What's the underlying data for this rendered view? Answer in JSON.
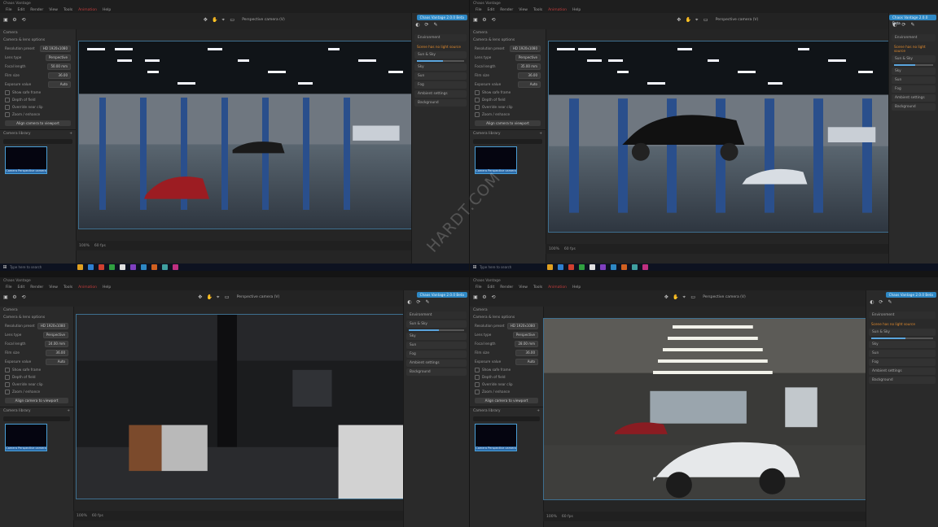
{
  "watermark": "HARDT.COM",
  "quadrants": [
    {
      "title": "Chaos Vantage",
      "menu": [
        "File",
        "Edit",
        "Render",
        "View",
        "Tools",
        "Animation",
        "Help"
      ],
      "viewport_label": "Perspective camera (V)",
      "left_section": "Camera",
      "left_subsection": "Camera & lens options",
      "rows": [
        {
          "label": "Resolution preset",
          "value": "HD 1920x1080"
        },
        {
          "label": "Lens type",
          "value": "Perspective"
        },
        {
          "label": "Focal length",
          "value": "50.00 mm"
        },
        {
          "label": "Film size",
          "value": "36.00"
        },
        {
          "label": "Exposure value",
          "value": "Auto"
        }
      ],
      "checks": [
        "Show safe frame",
        "Depth of field",
        "Override near clip",
        "Zoom / enhance"
      ],
      "button": "Align camera to viewport",
      "library": "Camera library",
      "thumb_caption": "Camera Perspective camera",
      "chip": "Chaos Vantage 2.0.0 Beta",
      "right_sections": [
        "Environment",
        "Sun & Sky",
        "Sky",
        "Sun",
        "Fog",
        "Ambient settings",
        "Background"
      ],
      "warning": "Scene has no light source",
      "status_zoom": "100%",
      "status_fps": "60 fps"
    },
    {
      "title": "Chaos Vantage",
      "menu": [
        "File",
        "Edit",
        "Render",
        "View",
        "Tools",
        "Animation",
        "Help"
      ],
      "viewport_label": "Perspective camera (V)",
      "left_section": "Camera",
      "left_subsection": "Camera & lens options",
      "rows": [
        {
          "label": "Resolution preset",
          "value": "HD 1920x1080"
        },
        {
          "label": "Lens type",
          "value": "Perspective"
        },
        {
          "label": "Focal length",
          "value": "35.00 mm"
        },
        {
          "label": "Film size",
          "value": "36.00"
        },
        {
          "label": "Exposure value",
          "value": "Auto"
        }
      ],
      "checks": [
        "Show safe frame",
        "Depth of field",
        "Override near clip",
        "Zoom / enhance"
      ],
      "button": "Align camera to viewport",
      "library": "Camera library",
      "thumb_caption": "Camera Perspective camera",
      "chip": "Chaos Vantage 2.0.0 Beta",
      "right_sections": [
        "Environment",
        "Sun & Sky",
        "Sky",
        "Sun",
        "Fog",
        "Ambient settings",
        "Background"
      ],
      "warning": "Scene has no light source",
      "status_zoom": "100%",
      "status_fps": "60 fps"
    },
    {
      "title": "Chaos Vantage",
      "menu": [
        "File",
        "Edit",
        "Render",
        "View",
        "Tools",
        "Animation",
        "Help"
      ],
      "viewport_label": "Perspective camera (V)",
      "left_section": "Camera",
      "left_subsection": "Camera & lens options",
      "rows": [
        {
          "label": "Resolution preset",
          "value": "HD 1920x1080"
        },
        {
          "label": "Lens type",
          "value": "Perspective"
        },
        {
          "label": "Focal length",
          "value": "24.00 mm"
        },
        {
          "label": "Film size",
          "value": "36.00"
        },
        {
          "label": "Exposure value",
          "value": "Auto"
        }
      ],
      "checks": [
        "Show safe frame",
        "Depth of field",
        "Override near clip",
        "Zoom / enhance"
      ],
      "button": "Align camera to viewport",
      "library": "Camera library",
      "thumb_caption": "Camera Perspective camera",
      "chip": "Chaos Vantage 2.0.0 Beta",
      "right_sections": [
        "Environment",
        "Sun & Sky",
        "Sky",
        "Sun",
        "Fog",
        "Ambient settings",
        "Background"
      ],
      "warning": "",
      "status_zoom": "100%",
      "status_fps": "60 fps"
    },
    {
      "title": "Chaos Vantage",
      "menu": [
        "File",
        "Edit",
        "Render",
        "View",
        "Tools",
        "Animation",
        "Help"
      ],
      "viewport_label": "Perspective camera (V)",
      "left_section": "Camera",
      "left_subsection": "Camera & lens options",
      "rows": [
        {
          "label": "Resolution preset",
          "value": "HD 1920x1080"
        },
        {
          "label": "Lens type",
          "value": "Perspective"
        },
        {
          "label": "Focal length",
          "value": "28.00 mm"
        },
        {
          "label": "Film size",
          "value": "36.00"
        },
        {
          "label": "Exposure value",
          "value": "Auto"
        }
      ],
      "checks": [
        "Show safe frame",
        "Depth of field",
        "Override near clip",
        "Zoom / enhance"
      ],
      "button": "Align camera to viewport",
      "library": "Camera library",
      "thumb_caption": "Camera Perspective camera",
      "chip": "Chaos Vantage 2.0.0 Beta",
      "right_sections": [
        "Environment",
        "Sun & Sky",
        "Sky",
        "Sun",
        "Fog",
        "Ambient settings",
        "Background"
      ],
      "warning": "Scene has no light source",
      "status_zoom": "100%",
      "status_fps": "60 fps"
    }
  ],
  "taskbar_search": "Type here to search",
  "colors": {
    "accent": "#2e88c4",
    "warning": "#e08a2e",
    "brand": "#c43c3c"
  }
}
